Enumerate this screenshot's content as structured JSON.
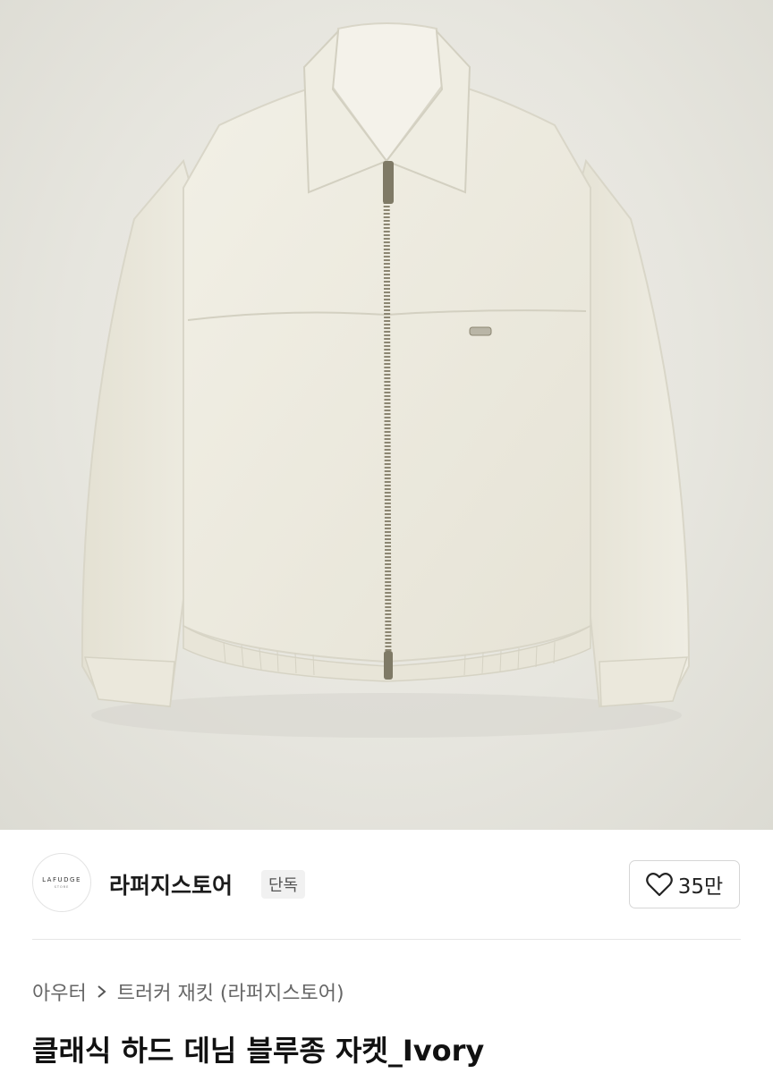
{
  "product_image": {
    "alt_subject": "ivory-denim-jacket",
    "colors": {
      "background": "#e8e7e0",
      "fabric": "#eeece1",
      "shadow": "#d8d5c8",
      "zipper": "#8c8672"
    }
  },
  "brand": {
    "logo_text": "LAFUDGE",
    "logo_subtext": "STORE",
    "name": "라퍼지스토어",
    "badge": "단독"
  },
  "like": {
    "icon": "heart-outline-icon",
    "count": "35만"
  },
  "breadcrumb": {
    "category": "아우터",
    "separator_icon": "chevron-right-icon",
    "subcategory": "트러커 재킷 (라퍼지스토어)"
  },
  "product": {
    "title": "클래식 하드 데님 블루종 자켓_Ivory"
  }
}
